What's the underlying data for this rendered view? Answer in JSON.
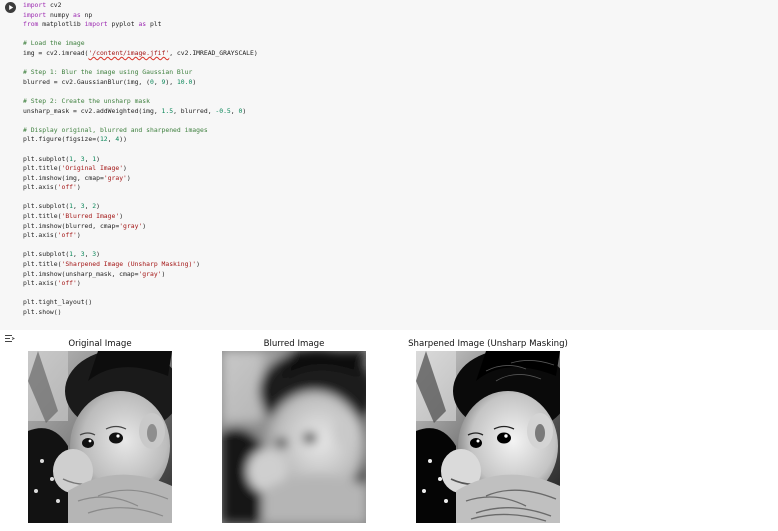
{
  "code_cell": {
    "lines": [
      [
        {
          "c": "kw",
          "t": "import"
        },
        {
          "c": "fn",
          "t": " cv2"
        }
      ],
      [
        {
          "c": "kw",
          "t": "import"
        },
        {
          "c": "fn",
          "t": " numpy "
        },
        {
          "c": "kw",
          "t": "as"
        },
        {
          "c": "fn",
          "t": " np"
        }
      ],
      [
        {
          "c": "kw",
          "t": "from"
        },
        {
          "c": "fn",
          "t": " matplotlib "
        },
        {
          "c": "kw",
          "t": "import"
        },
        {
          "c": "fn",
          "t": " pyplot "
        },
        {
          "c": "kw",
          "t": "as"
        },
        {
          "c": "fn",
          "t": " plt"
        }
      ],
      [],
      [
        {
          "c": "cm",
          "t": "# Load the image"
        }
      ],
      [
        {
          "c": "fn",
          "t": "img = cv2.imread("
        },
        {
          "c": "str path-err",
          "t": "'/content/image.jfif'"
        },
        {
          "c": "fn",
          "t": ", cv2.IMREAD_GRAYSCALE)"
        }
      ],
      [],
      [
        {
          "c": "cm",
          "t": "# Step 1: Blur the image using Gaussian Blur"
        }
      ],
      [
        {
          "c": "fn",
          "t": "blurred = cv2.GaussianBlur(img, ("
        },
        {
          "c": "num",
          "t": "0"
        },
        {
          "c": "fn",
          "t": ", "
        },
        {
          "c": "num",
          "t": "9"
        },
        {
          "c": "fn",
          "t": "), "
        },
        {
          "c": "num",
          "t": "10.0"
        },
        {
          "c": "fn",
          "t": ")"
        }
      ],
      [],
      [
        {
          "c": "cm",
          "t": "# Step 2: Create the unsharp mask"
        }
      ],
      [
        {
          "c": "fn",
          "t": "unsharp_mask = cv2.addWeighted(img, "
        },
        {
          "c": "num",
          "t": "1.5"
        },
        {
          "c": "fn",
          "t": ", blurred, "
        },
        {
          "c": "num",
          "t": "-0.5"
        },
        {
          "c": "fn",
          "t": ", "
        },
        {
          "c": "num",
          "t": "0"
        },
        {
          "c": "fn",
          "t": ")"
        }
      ],
      [],
      [
        {
          "c": "cm",
          "t": "# Display original, blurred and sharpened images"
        }
      ],
      [
        {
          "c": "fn",
          "t": "plt.figure(figsize=("
        },
        {
          "c": "num",
          "t": "12"
        },
        {
          "c": "fn",
          "t": ", "
        },
        {
          "c": "num",
          "t": "4"
        },
        {
          "c": "fn",
          "t": "))"
        }
      ],
      [],
      [
        {
          "c": "fn",
          "t": "plt.subplot("
        },
        {
          "c": "num",
          "t": "1"
        },
        {
          "c": "fn",
          "t": ", "
        },
        {
          "c": "num",
          "t": "3"
        },
        {
          "c": "fn",
          "t": ", "
        },
        {
          "c": "num",
          "t": "1"
        },
        {
          "c": "fn",
          "t": ")"
        }
      ],
      [
        {
          "c": "fn",
          "t": "plt.title("
        },
        {
          "c": "str",
          "t": "'Original Image'"
        },
        {
          "c": "fn",
          "t": ")"
        }
      ],
      [
        {
          "c": "fn",
          "t": "plt.imshow(img, cmap="
        },
        {
          "c": "str",
          "t": "'gray'"
        },
        {
          "c": "fn",
          "t": ")"
        }
      ],
      [
        {
          "c": "fn",
          "t": "plt.axis("
        },
        {
          "c": "str",
          "t": "'off'"
        },
        {
          "c": "fn",
          "t": ")"
        }
      ],
      [],
      [
        {
          "c": "fn",
          "t": "plt.subplot("
        },
        {
          "c": "num",
          "t": "1"
        },
        {
          "c": "fn",
          "t": ", "
        },
        {
          "c": "num",
          "t": "3"
        },
        {
          "c": "fn",
          "t": ", "
        },
        {
          "c": "num",
          "t": "2"
        },
        {
          "c": "fn",
          "t": ")"
        }
      ],
      [
        {
          "c": "fn",
          "t": "plt.title("
        },
        {
          "c": "str",
          "t": "'Blurred Image'"
        },
        {
          "c": "fn",
          "t": ")"
        }
      ],
      [
        {
          "c": "fn",
          "t": "plt.imshow(blurred, cmap="
        },
        {
          "c": "str",
          "t": "'gray'"
        },
        {
          "c": "fn",
          "t": ")"
        }
      ],
      [
        {
          "c": "fn",
          "t": "plt.axis("
        },
        {
          "c": "str",
          "t": "'off'"
        },
        {
          "c": "fn",
          "t": ")"
        }
      ],
      [],
      [
        {
          "c": "fn",
          "t": "plt.subplot("
        },
        {
          "c": "num",
          "t": "1"
        },
        {
          "c": "fn",
          "t": ", "
        },
        {
          "c": "num",
          "t": "3"
        },
        {
          "c": "fn",
          "t": ", "
        },
        {
          "c": "num",
          "t": "3"
        },
        {
          "c": "fn",
          "t": ")"
        }
      ],
      [
        {
          "c": "fn",
          "t": "plt.title("
        },
        {
          "c": "str",
          "t": "'Sharpened Image (Unsharp Masking)'"
        },
        {
          "c": "fn",
          "t": ")"
        }
      ],
      [
        {
          "c": "fn",
          "t": "plt.imshow(unsharp_mask, cmap="
        },
        {
          "c": "str",
          "t": "'gray'"
        },
        {
          "c": "fn",
          "t": ")"
        }
      ],
      [
        {
          "c": "fn",
          "t": "plt.axis("
        },
        {
          "c": "str",
          "t": "'off'"
        },
        {
          "c": "fn",
          "t": ")"
        }
      ],
      [],
      [
        {
          "c": "fn",
          "t": "plt.tight_layout()"
        }
      ],
      [
        {
          "c": "fn",
          "t": "plt.show()"
        }
      ]
    ]
  },
  "output": {
    "figures": [
      {
        "title": "Original Image",
        "image": "baby-photo-original"
      },
      {
        "title": "Blurred Image",
        "image": "baby-photo-blurred"
      },
      {
        "title": "Sharpened Image (Unsharp Masking)",
        "image": "baby-photo-sharpened"
      }
    ]
  },
  "icons": {
    "run": "play-icon",
    "output_toggle": "output-settings-icon"
  },
  "colors": {
    "cell_background": "#f7f7f7",
    "keyword": "#9b27b0",
    "string": "#a31515",
    "number": "#098658",
    "comment": "#3d7f3d"
  }
}
